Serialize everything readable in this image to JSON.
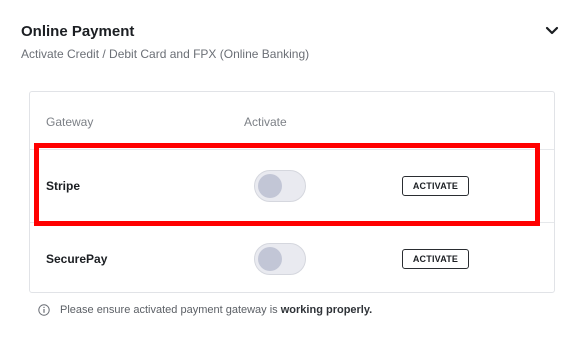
{
  "section": {
    "title": "Online Payment",
    "subtitle": "Activate Credit / Debit Card and FPX (Online Banking)",
    "collapse_icon": "chevron-down-icon"
  },
  "table": {
    "headers": {
      "gateway": "Gateway",
      "activate": "Activate"
    },
    "rows": [
      {
        "name": "Stripe",
        "active": false,
        "button_label": "ACTIVATE",
        "highlighted": true
      },
      {
        "name": "SecurePay",
        "active": false,
        "button_label": "ACTIVATE",
        "highlighted": false
      }
    ]
  },
  "note": {
    "icon": "info-icon",
    "text_prefix": "Please ensure activated payment gateway is ",
    "text_strong": "working properly."
  },
  "colors": {
    "highlight": "#ff0000",
    "toggle_track": "#e9eaf0",
    "toggle_knob": "#c2c6d6"
  }
}
